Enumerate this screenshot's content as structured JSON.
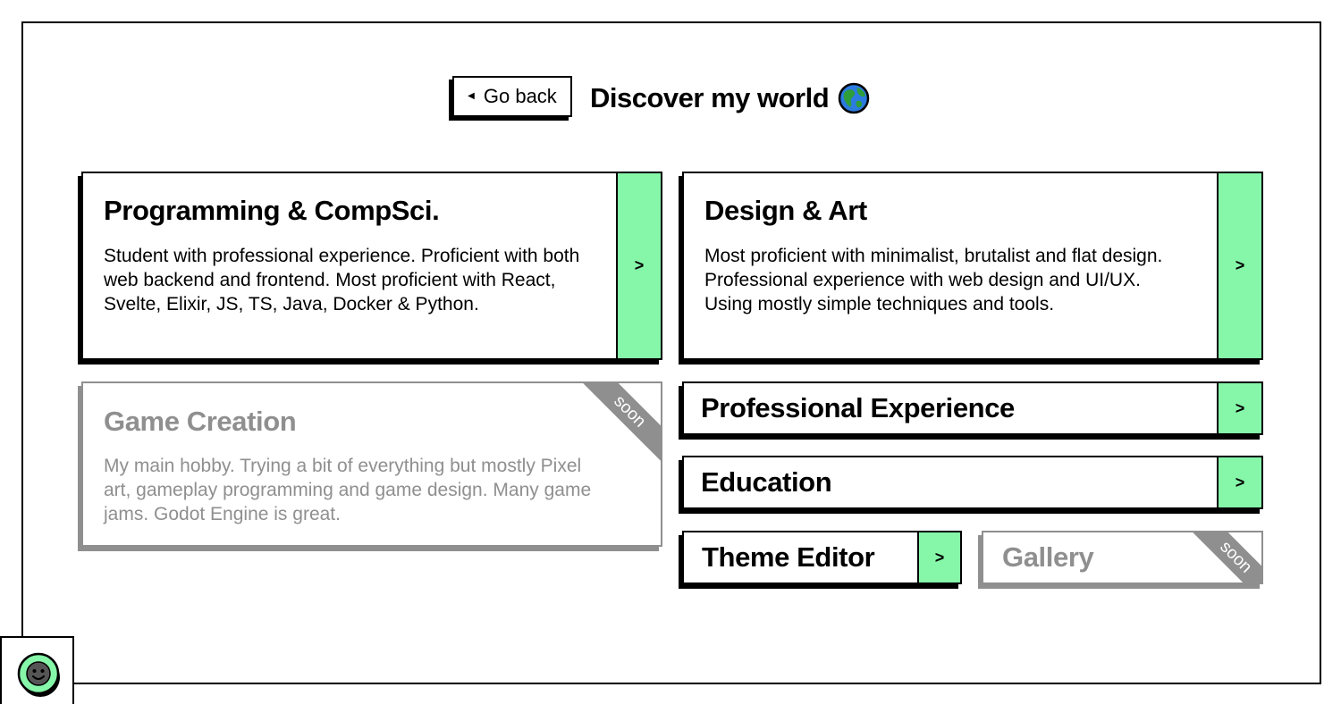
{
  "header": {
    "back_label": "Go back",
    "title": "Discover my world"
  },
  "colors": {
    "accent": "#86f7a9",
    "disabled": "#8f8f8f",
    "globe_ocean": "#2b7be0",
    "globe_land": "#2e9e3a"
  },
  "cards": {
    "programming": {
      "title": "Programming & CompSci.",
      "description": "Student with professional experience. Proficient with both web backend and frontend. Most proficient with React, Svelte, Elixir, JS, TS, Java, Docker & Python.",
      "arrow": ">"
    },
    "design": {
      "title": "Design & Art",
      "description": "Most proficient with minimalist, brutalist and flat design. Professional experience with web design and UI/UX. Using mostly simple techniques and tools.",
      "arrow": ">"
    },
    "game": {
      "title": "Game Creation",
      "description": "My main hobby. Trying a bit of everything but mostly Pixel art, gameplay programming and game design. Many game jams. Godot Engine is great.",
      "badge": "soon"
    },
    "experience": {
      "title": "Professional Experience",
      "arrow": ">"
    },
    "education": {
      "title": "Education",
      "arrow": ">"
    },
    "theme_editor": {
      "title": "Theme Editor",
      "arrow": ">"
    },
    "gallery": {
      "title": "Gallery",
      "badge": "soon"
    }
  },
  "icons": {
    "back": "back-triangle-icon",
    "globe": "globe-icon",
    "avatar": "smiley-avatar-icon"
  }
}
